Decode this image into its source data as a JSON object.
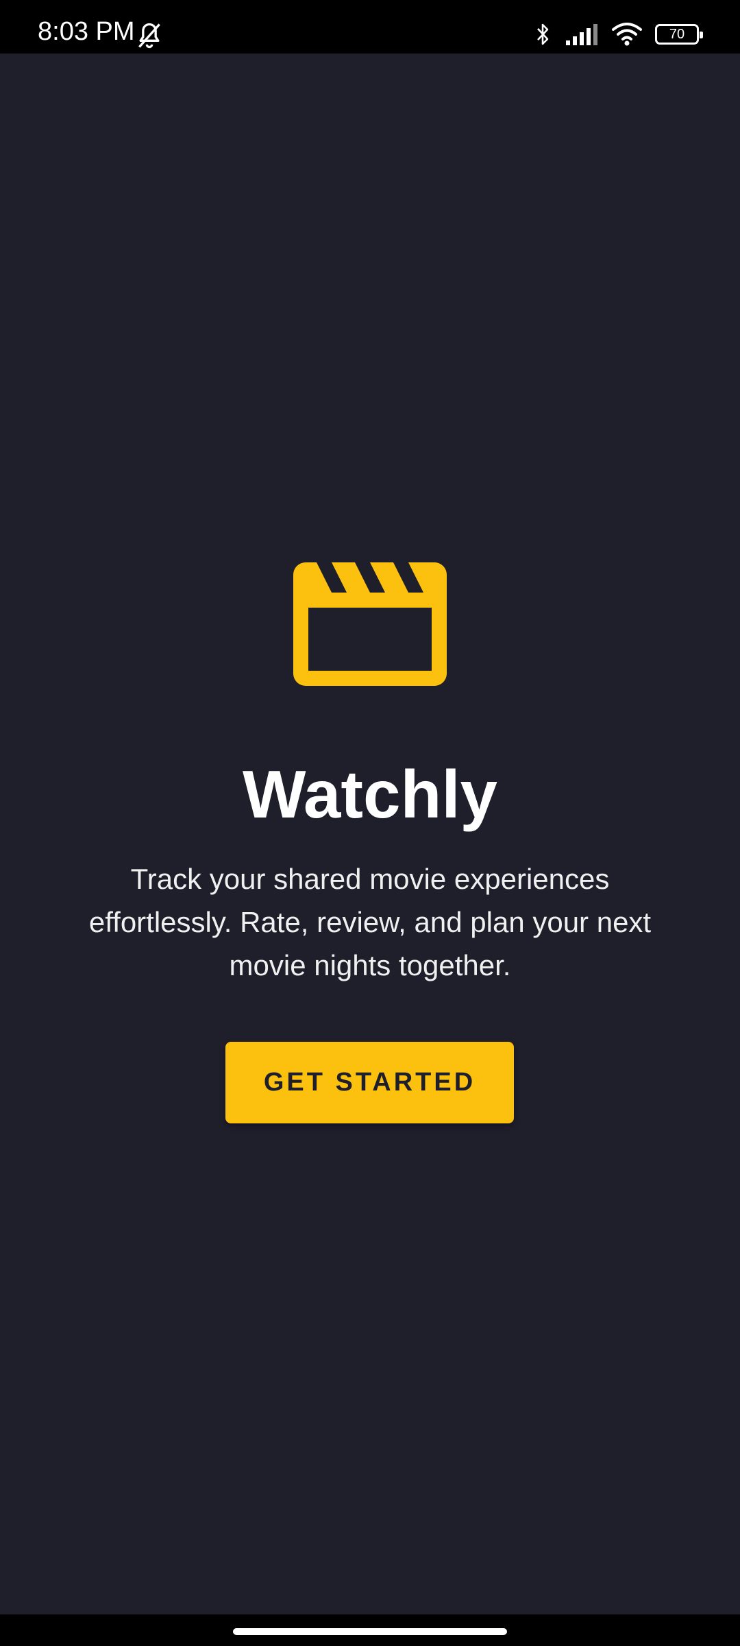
{
  "status_bar": {
    "time": "8:03 PM",
    "battery_level": "70",
    "icons": [
      "bell-off-icon",
      "bluetooth-icon",
      "signal-icon",
      "wifi-icon",
      "battery-icon"
    ]
  },
  "app": {
    "logo_icon": "clapperboard-icon",
    "title": "Watchly",
    "tagline": "Track your shared movie experiences effortlessly. Rate, review, and plan your next movie nights together.",
    "cta_label": "GET STARTED"
  },
  "colors": {
    "background": "#1f1e2b",
    "accent": "#fcc00e",
    "text_primary": "#ffffff"
  }
}
